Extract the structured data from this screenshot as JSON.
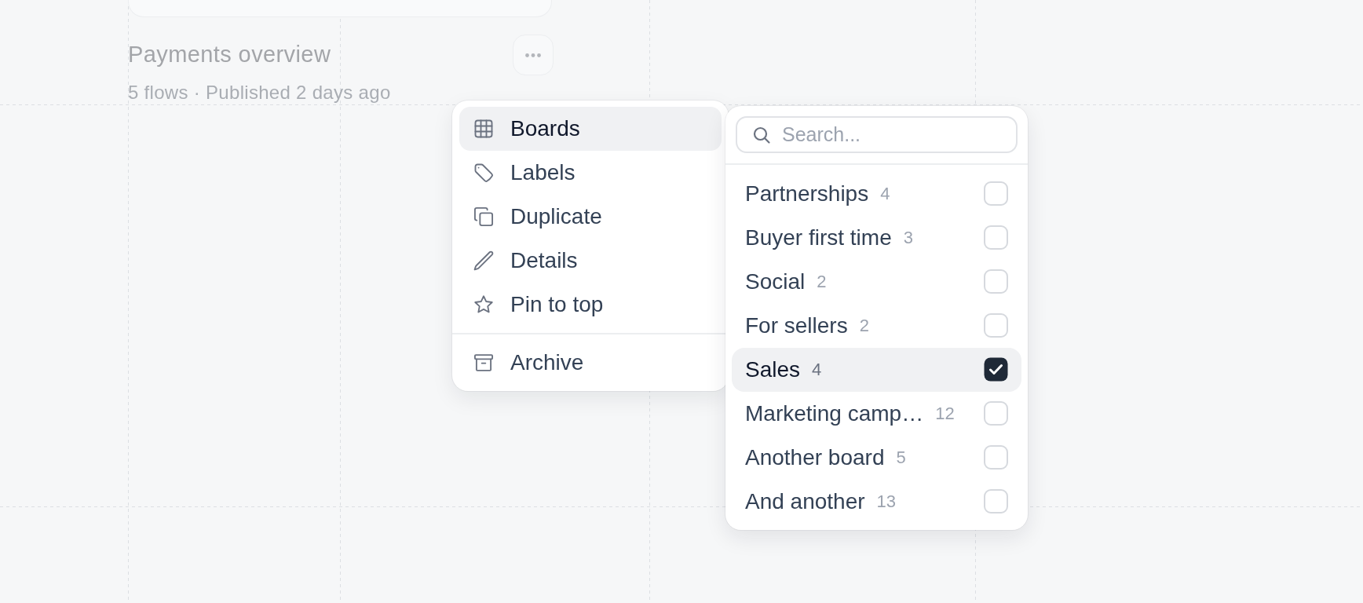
{
  "card": {
    "title": "Payments overview",
    "meta": "5 flows · Published 2 days ago"
  },
  "menu": {
    "sections": [
      {
        "items": [
          {
            "label": "Boards",
            "selected": true
          },
          {
            "label": "Labels",
            "selected": false
          },
          {
            "label": "Duplicate",
            "selected": false
          },
          {
            "label": "Details",
            "selected": false
          },
          {
            "label": "Pin to top",
            "selected": false
          }
        ]
      },
      {
        "items": [
          {
            "label": "Archive",
            "selected": false
          }
        ]
      }
    ]
  },
  "boards_panel": {
    "search": {
      "placeholder": "Search..."
    },
    "boards": [
      {
        "name": "Partnerships",
        "count": "4",
        "checked": false,
        "selected": false
      },
      {
        "name": "Buyer first time",
        "count": "3",
        "checked": false,
        "selected": false
      },
      {
        "name": "Social",
        "count": "2",
        "checked": false,
        "selected": false
      },
      {
        "name": "For sellers",
        "count": "2",
        "checked": false,
        "selected": false
      },
      {
        "name": "Sales",
        "count": "4",
        "checked": true,
        "selected": true
      },
      {
        "name": "Marketing camp…",
        "count": "12",
        "checked": false,
        "selected": false
      },
      {
        "name": "Another board",
        "count": "5",
        "checked": false,
        "selected": false
      },
      {
        "name": "And another",
        "count": "13",
        "checked": false,
        "selected": false
      }
    ]
  }
}
